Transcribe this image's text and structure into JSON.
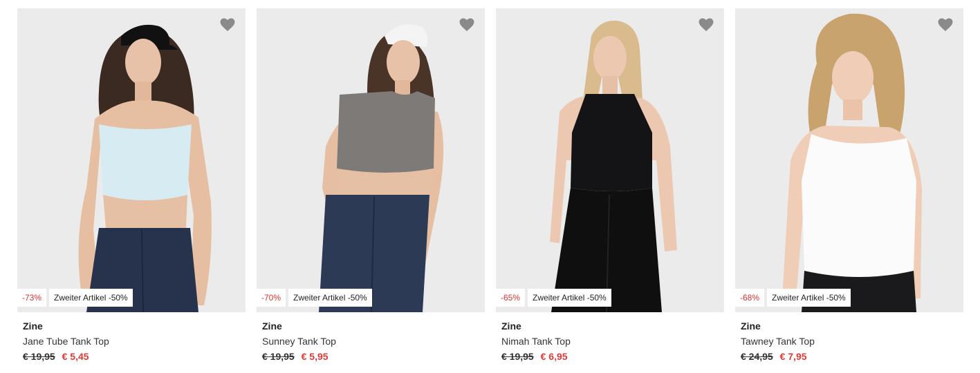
{
  "products": [
    {
      "brand": "Zine",
      "name": "Jane Tube Tank Top",
      "old_price": "€ 19,95",
      "new_price": "€ 5,45",
      "discount": "-73%",
      "promo": "Zweiter Artikel -50%",
      "wishlist_icon": "heart-icon"
    },
    {
      "brand": "Zine",
      "name": "Sunney Tank Top",
      "old_price": "€ 19,95",
      "new_price": "€ 5,95",
      "discount": "-70%",
      "promo": "Zweiter Artikel -50%",
      "wishlist_icon": "heart-icon"
    },
    {
      "brand": "Zine",
      "name": "Nimah Tank Top",
      "old_price": "€ 19,95",
      "new_price": "€ 6,95",
      "discount": "-65%",
      "promo": "Zweiter Artikel -50%",
      "wishlist_icon": "heart-icon"
    },
    {
      "brand": "Zine",
      "name": "Tawney Tank Top",
      "old_price": "€ 24,95",
      "new_price": "€ 7,95",
      "discount": "-68%",
      "promo": "Zweiter Artikel -50%",
      "wishlist_icon": "heart-icon"
    }
  ],
  "colors": {
    "image_bg": "#ebebeb",
    "sale_red": "#e03a36",
    "heart_gray": "#8a8a8a"
  }
}
